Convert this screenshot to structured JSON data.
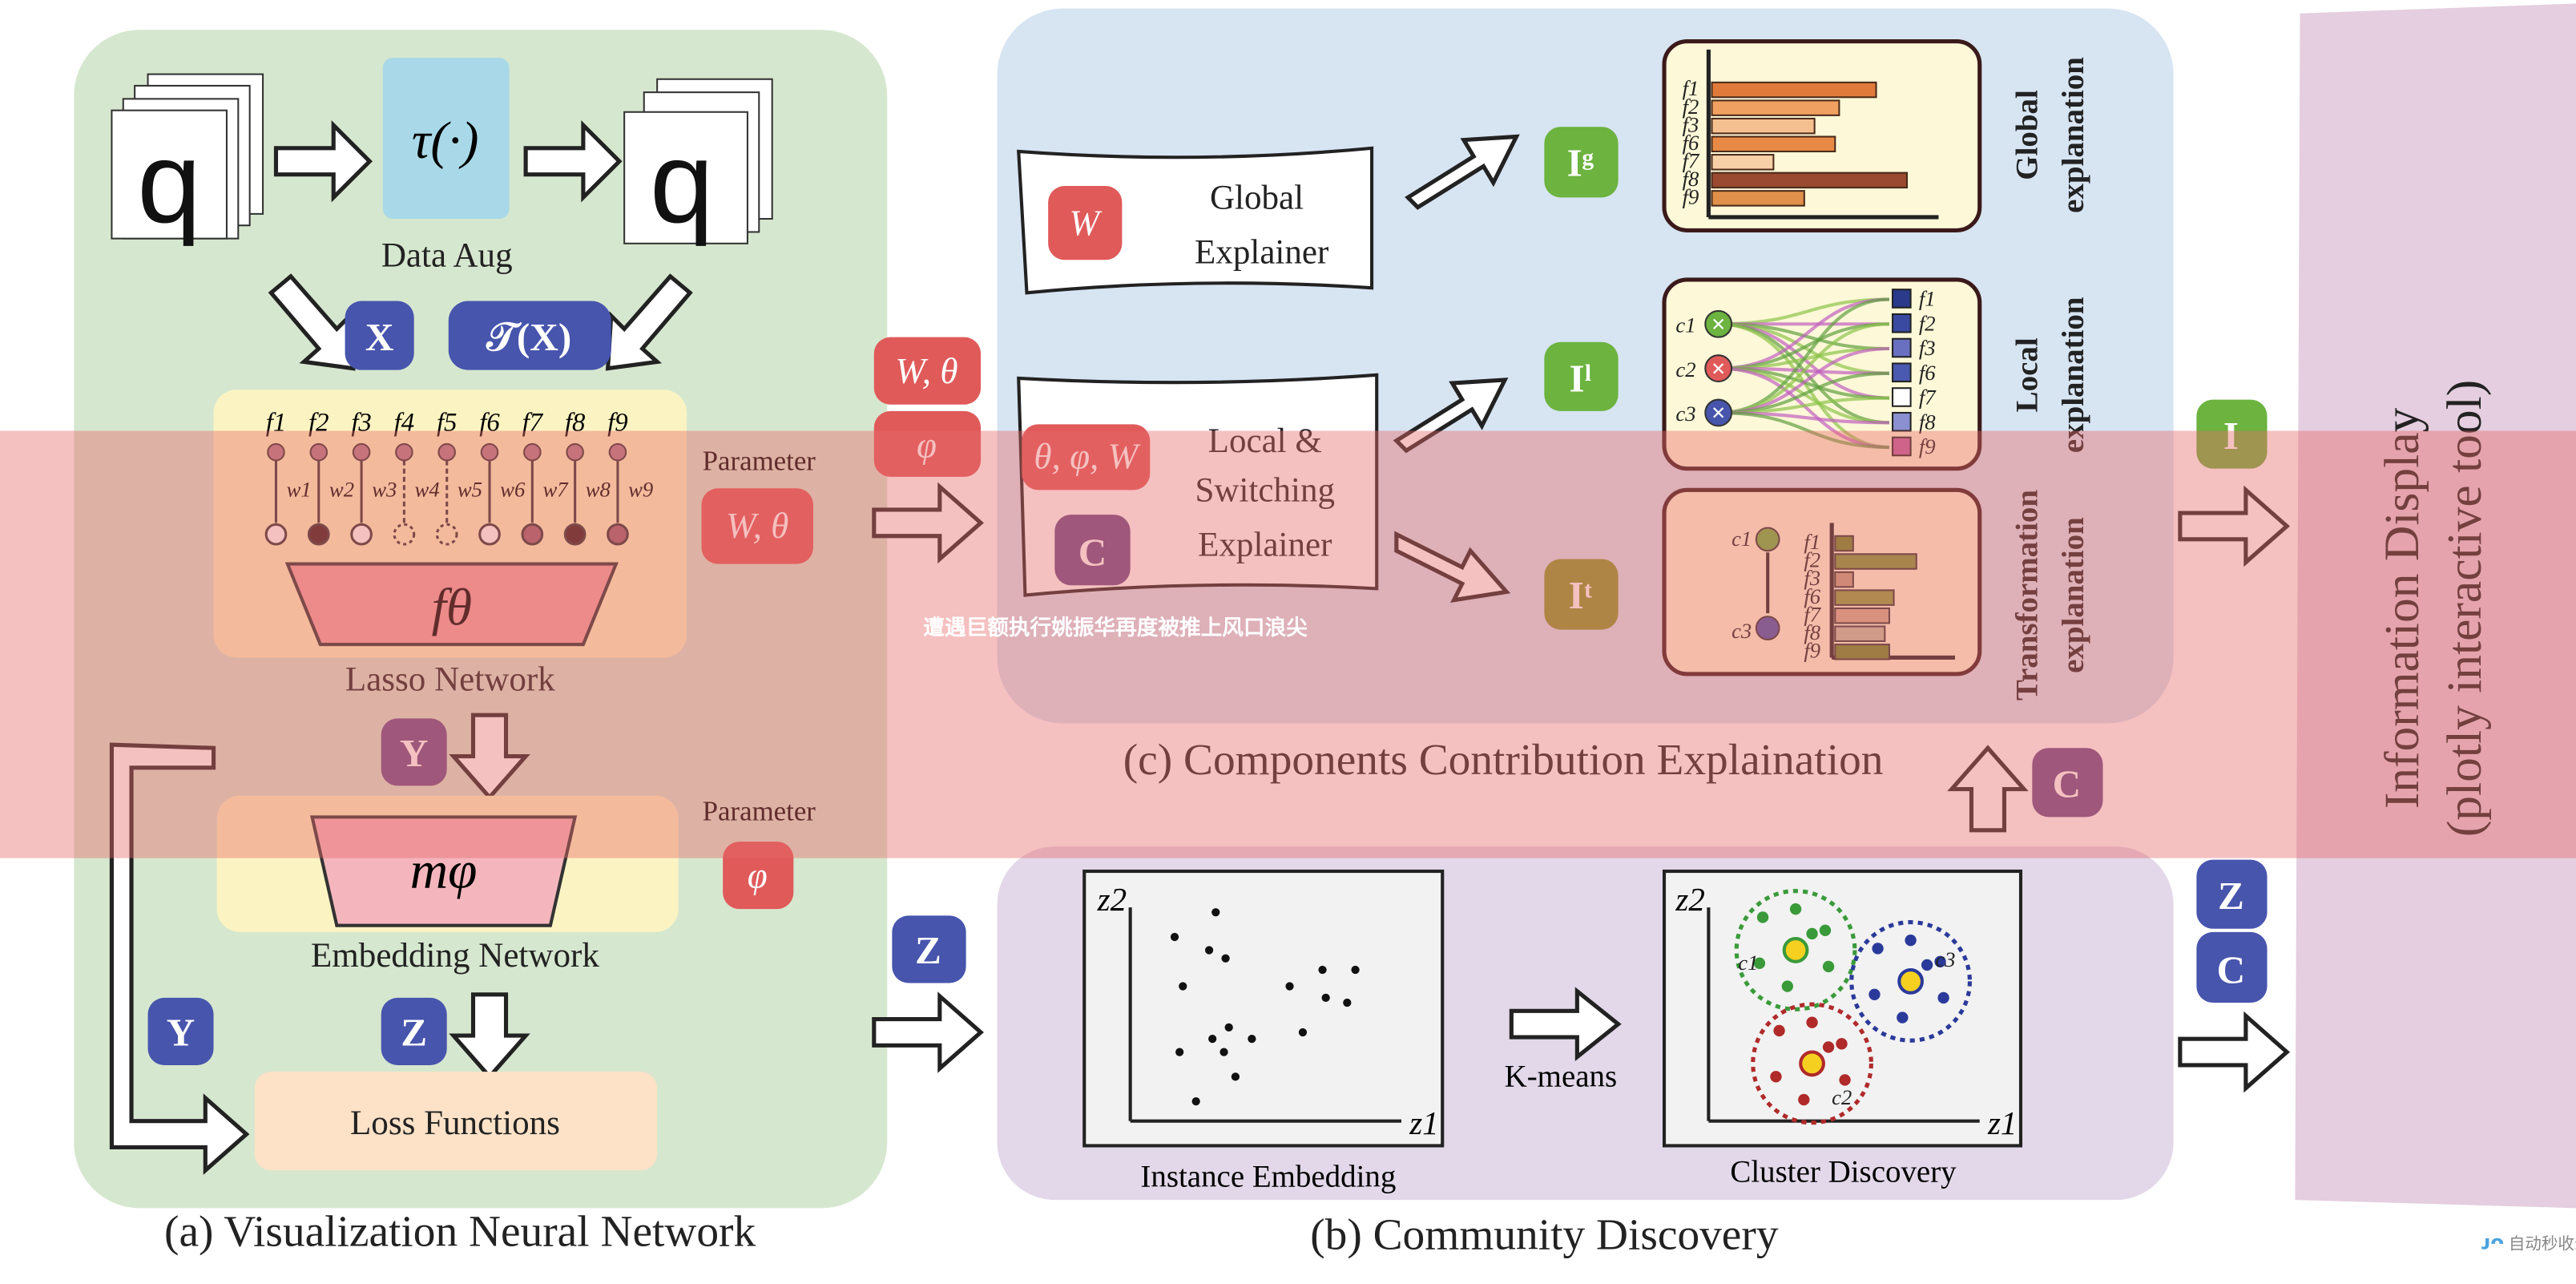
{
  "panel_a": {
    "caption": "(a) Visualization Neural Network",
    "data_aug": "Data Aug",
    "tau": "τ(·)",
    "x_badge": "X",
    "tx_badge": "𝒯(X)",
    "features": [
      "f1",
      "f2",
      "f3",
      "f4",
      "f5",
      "f6",
      "f7",
      "f8",
      "f9"
    ],
    "weights": [
      "w1",
      "w2",
      "w3",
      "w4",
      "w5",
      "w6",
      "w7",
      "w8",
      "w9"
    ],
    "f_theta": "fθ",
    "lasso_label": "Lasso Network",
    "parameter1": "Parameter",
    "param1_badge": "W, θ",
    "y_badge": "Y",
    "m_phi": "mφ",
    "embedding_label": "Embedding Network",
    "parameter2": "Parameter",
    "param2_badge": "φ",
    "z_badge": "Z",
    "y_badge2": "Y",
    "loss": "Loss Functions"
  },
  "middle": {
    "w_theta": "W, θ",
    "phi": "φ",
    "z": "Z"
  },
  "panel_c": {
    "caption": "(c) Components Contribution Explaination",
    "global_explainer": [
      "Global",
      "Explainer"
    ],
    "w_badge": "W",
    "local_explainer": [
      "Local &",
      "Switching",
      "Explainer"
    ],
    "tpw_badge": "θ, φ, W",
    "c_badge": "C",
    "ig": "Iᵍ",
    "il": "Iˡ",
    "it": "Iᵗ",
    "global_title": [
      "Global",
      "explanation"
    ],
    "local_title": [
      "Local",
      "explanation"
    ],
    "trans_title": [
      "Transformation",
      "explanation"
    ],
    "global_bars": {
      "labels": [
        "f1",
        "f2",
        "f3",
        "f6",
        "f7",
        "f8",
        "f9"
      ],
      "values": [
        0.8,
        0.62,
        0.5,
        0.6,
        0.3,
        0.95,
        0.45
      ]
    },
    "clusters": [
      "c1",
      "c2",
      "c3"
    ],
    "local_features": [
      "f1",
      "f2",
      "f3",
      "f6",
      "f7",
      "f8",
      "f9"
    ],
    "trans_bars": {
      "labels": [
        "f1",
        "f2",
        "f3",
        "f6",
        "f7",
        "f8",
        "f9"
      ],
      "values": [
        0.2,
        0.9,
        0.2,
        0.65,
        0.6,
        0.55,
        0.6
      ]
    }
  },
  "panel_b": {
    "caption": "(b) Community Discovery",
    "instance_label": "Instance Embedding",
    "kmeans": "K-means",
    "cluster_label": "Cluster Discovery",
    "z1": "z1",
    "z2": "z2",
    "c_labels": [
      "c1",
      "c2",
      "c3"
    ]
  },
  "right": {
    "i_badge": "I",
    "c_badge": "C",
    "z_badge": "Z",
    "c_badge2": "C",
    "title1": "Information Display",
    "title2": "(plotly interactive tool)"
  },
  "overlay_text": "遭遇巨额执行姚振华再度被推上风口浪尖",
  "watermark": "自动秒收录",
  "colors": {
    "green_panel": "#d6e7cf",
    "blue_panel": "#d7e4f2",
    "purple_panel": "#e2d8e9",
    "display_panel": "#e4cedf",
    "red_badge": "#e05a5a",
    "blue_badge": "#4755ad",
    "purple_badge": "#6b4a88",
    "green_badge": "#6cb33f",
    "overlay": "#e86a6a"
  }
}
